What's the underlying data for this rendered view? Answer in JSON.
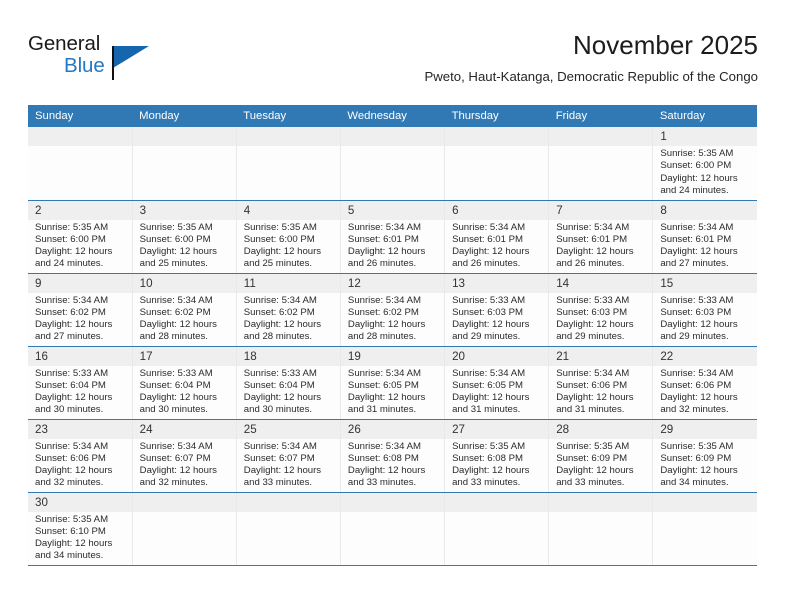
{
  "brand": {
    "name_part1": "General",
    "name_part2": "Blue",
    "accent_color": "#2379c4",
    "triangle_color": "#1566ad",
    "logo_icon": "general-blue-logo"
  },
  "header": {
    "title": "November 2025",
    "subtitle": "Pweto, Haut-Katanga, Democratic Republic of the Congo"
  },
  "calendar": {
    "header_bg": "#3179b5",
    "daynum_bg": "#efefef",
    "row_border_color": "#3179b5",
    "weekdays": [
      "Sunday",
      "Monday",
      "Tuesday",
      "Wednesday",
      "Thursday",
      "Friday",
      "Saturday"
    ],
    "labels": {
      "sunrise": "Sunrise:",
      "sunset": "Sunset:",
      "daylight": "Daylight:"
    },
    "weeks": [
      [
        {
          "blank": true
        },
        {
          "blank": true
        },
        {
          "blank": true
        },
        {
          "blank": true
        },
        {
          "blank": true
        },
        {
          "blank": true
        },
        {
          "day": "1",
          "sunrise": "Sunrise: 5:35 AM",
          "sunset": "Sunset: 6:00 PM",
          "daylight": "Daylight: 12 hours and 24 minutes."
        }
      ],
      [
        {
          "day": "2",
          "sunrise": "Sunrise: 5:35 AM",
          "sunset": "Sunset: 6:00 PM",
          "daylight": "Daylight: 12 hours and 24 minutes."
        },
        {
          "day": "3",
          "sunrise": "Sunrise: 5:35 AM",
          "sunset": "Sunset: 6:00 PM",
          "daylight": "Daylight: 12 hours and 25 minutes."
        },
        {
          "day": "4",
          "sunrise": "Sunrise: 5:35 AM",
          "sunset": "Sunset: 6:00 PM",
          "daylight": "Daylight: 12 hours and 25 minutes."
        },
        {
          "day": "5",
          "sunrise": "Sunrise: 5:34 AM",
          "sunset": "Sunset: 6:01 PM",
          "daylight": "Daylight: 12 hours and 26 minutes."
        },
        {
          "day": "6",
          "sunrise": "Sunrise: 5:34 AM",
          "sunset": "Sunset: 6:01 PM",
          "daylight": "Daylight: 12 hours and 26 minutes."
        },
        {
          "day": "7",
          "sunrise": "Sunrise: 5:34 AM",
          "sunset": "Sunset: 6:01 PM",
          "daylight": "Daylight: 12 hours and 26 minutes."
        },
        {
          "day": "8",
          "sunrise": "Sunrise: 5:34 AM",
          "sunset": "Sunset: 6:01 PM",
          "daylight": "Daylight: 12 hours and 27 minutes."
        }
      ],
      [
        {
          "day": "9",
          "sunrise": "Sunrise: 5:34 AM",
          "sunset": "Sunset: 6:02 PM",
          "daylight": "Daylight: 12 hours and 27 minutes."
        },
        {
          "day": "10",
          "sunrise": "Sunrise: 5:34 AM",
          "sunset": "Sunset: 6:02 PM",
          "daylight": "Daylight: 12 hours and 28 minutes."
        },
        {
          "day": "11",
          "sunrise": "Sunrise: 5:34 AM",
          "sunset": "Sunset: 6:02 PM",
          "daylight": "Daylight: 12 hours and 28 minutes."
        },
        {
          "day": "12",
          "sunrise": "Sunrise: 5:34 AM",
          "sunset": "Sunset: 6:02 PM",
          "daylight": "Daylight: 12 hours and 28 minutes."
        },
        {
          "day": "13",
          "sunrise": "Sunrise: 5:33 AM",
          "sunset": "Sunset: 6:03 PM",
          "daylight": "Daylight: 12 hours and 29 minutes."
        },
        {
          "day": "14",
          "sunrise": "Sunrise: 5:33 AM",
          "sunset": "Sunset: 6:03 PM",
          "daylight": "Daylight: 12 hours and 29 minutes."
        },
        {
          "day": "15",
          "sunrise": "Sunrise: 5:33 AM",
          "sunset": "Sunset: 6:03 PM",
          "daylight": "Daylight: 12 hours and 29 minutes."
        }
      ],
      [
        {
          "day": "16",
          "sunrise": "Sunrise: 5:33 AM",
          "sunset": "Sunset: 6:04 PM",
          "daylight": "Daylight: 12 hours and 30 minutes."
        },
        {
          "day": "17",
          "sunrise": "Sunrise: 5:33 AM",
          "sunset": "Sunset: 6:04 PM",
          "daylight": "Daylight: 12 hours and 30 minutes."
        },
        {
          "day": "18",
          "sunrise": "Sunrise: 5:33 AM",
          "sunset": "Sunset: 6:04 PM",
          "daylight": "Daylight: 12 hours and 30 minutes."
        },
        {
          "day": "19",
          "sunrise": "Sunrise: 5:34 AM",
          "sunset": "Sunset: 6:05 PM",
          "daylight": "Daylight: 12 hours and 31 minutes."
        },
        {
          "day": "20",
          "sunrise": "Sunrise: 5:34 AM",
          "sunset": "Sunset: 6:05 PM",
          "daylight": "Daylight: 12 hours and 31 minutes."
        },
        {
          "day": "21",
          "sunrise": "Sunrise: 5:34 AM",
          "sunset": "Sunset: 6:06 PM",
          "daylight": "Daylight: 12 hours and 31 minutes."
        },
        {
          "day": "22",
          "sunrise": "Sunrise: 5:34 AM",
          "sunset": "Sunset: 6:06 PM",
          "daylight": "Daylight: 12 hours and 32 minutes."
        }
      ],
      [
        {
          "day": "23",
          "sunrise": "Sunrise: 5:34 AM",
          "sunset": "Sunset: 6:06 PM",
          "daylight": "Daylight: 12 hours and 32 minutes."
        },
        {
          "day": "24",
          "sunrise": "Sunrise: 5:34 AM",
          "sunset": "Sunset: 6:07 PM",
          "daylight": "Daylight: 12 hours and 32 minutes."
        },
        {
          "day": "25",
          "sunrise": "Sunrise: 5:34 AM",
          "sunset": "Sunset: 6:07 PM",
          "daylight": "Daylight: 12 hours and 33 minutes."
        },
        {
          "day": "26",
          "sunrise": "Sunrise: 5:34 AM",
          "sunset": "Sunset: 6:08 PM",
          "daylight": "Daylight: 12 hours and 33 minutes."
        },
        {
          "day": "27",
          "sunrise": "Sunrise: 5:35 AM",
          "sunset": "Sunset: 6:08 PM",
          "daylight": "Daylight: 12 hours and 33 minutes."
        },
        {
          "day": "28",
          "sunrise": "Sunrise: 5:35 AM",
          "sunset": "Sunset: 6:09 PM",
          "daylight": "Daylight: 12 hours and 33 minutes."
        },
        {
          "day": "29",
          "sunrise": "Sunrise: 5:35 AM",
          "sunset": "Sunset: 6:09 PM",
          "daylight": "Daylight: 12 hours and 34 minutes."
        }
      ],
      [
        {
          "day": "30",
          "sunrise": "Sunrise: 5:35 AM",
          "sunset": "Sunset: 6:10 PM",
          "daylight": "Daylight: 12 hours and 34 minutes."
        },
        {
          "blank": true
        },
        {
          "blank": true
        },
        {
          "blank": true
        },
        {
          "blank": true
        },
        {
          "blank": true
        },
        {
          "blank": true
        }
      ]
    ]
  }
}
